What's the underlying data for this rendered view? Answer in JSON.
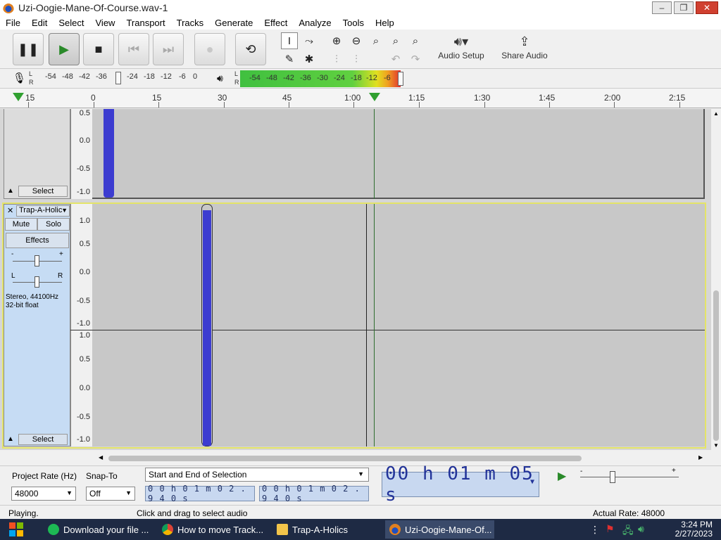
{
  "window": {
    "title": "Uzi-Oogie-Mane-Of-Course.wav-1",
    "minimize": "‒",
    "restore": "❐",
    "close": "✕"
  },
  "menu": [
    "File",
    "Edit",
    "Select",
    "View",
    "Transport",
    "Tracks",
    "Generate",
    "Effect",
    "Analyze",
    "Tools",
    "Help"
  ],
  "toolbar": {
    "audio_setup": "Audio Setup",
    "share_audio": "Share Audio"
  },
  "meters": {
    "record_scale": [
      "-54",
      "-48",
      "-42",
      "-36",
      "-24",
      "-18",
      "-12",
      "-6",
      "0"
    ],
    "play_scale": [
      "-54",
      "-48",
      "-42",
      "-36",
      "-30",
      "-24",
      "-18",
      "-12",
      "-6"
    ],
    "l": "L",
    "r": "R"
  },
  "timeline": {
    "labels": [
      "15",
      "0",
      "15",
      "30",
      "45",
      "1:00",
      "1:15",
      "1:30",
      "1:45",
      "2:00",
      "2:15"
    ]
  },
  "track1": {
    "select": "Select",
    "ruler": [
      "0.5",
      "0.0",
      "-0.5",
      "-1.0"
    ]
  },
  "track2": {
    "name": "Trap-A-Holic",
    "mute": "Mute",
    "solo": "Solo",
    "effects": "Effects",
    "gain_minus": "-",
    "gain_plus": "+",
    "pan_l": "L",
    "pan_r": "R",
    "info1": "Stereo, 44100Hz",
    "info2": "32-bit float",
    "select": "Select",
    "ruler_top": [
      "1.0",
      "0.5",
      "0.0",
      "-0.5",
      "-1.0"
    ],
    "ruler_bottom": [
      "1.0",
      "0.5",
      "0.0",
      "-0.5",
      "-1.0"
    ]
  },
  "bottom": {
    "project_rate_label": "Project Rate (Hz)",
    "snap_to_label": "Snap-To",
    "project_rate": "48000",
    "snap_to": "Off",
    "selection_mode": "Start and End of Selection",
    "sel_start": "0 0 h 0 1 m 0 2 . 9 4 0 s",
    "sel_end": "0 0 h 0 1 m 0 2 . 9 4 0 s",
    "time": "00 h 01 m 05 s"
  },
  "status": {
    "left": "Playing.",
    "middle": "Click and drag to select audio",
    "right": "Actual Rate: 48000"
  },
  "taskbar": {
    "items": [
      "Download your file ...",
      "How to move Track...",
      "Trap-A-Holics",
      "Uzi-Oogie-Mane-Of..."
    ],
    "clock_time": "3:24 PM",
    "clock_date": "2/27/2023"
  },
  "colors": {
    "waveform": "#3c3cd0",
    "selected_track": "#c6dcf4",
    "taskbar": "#1e2a44"
  }
}
